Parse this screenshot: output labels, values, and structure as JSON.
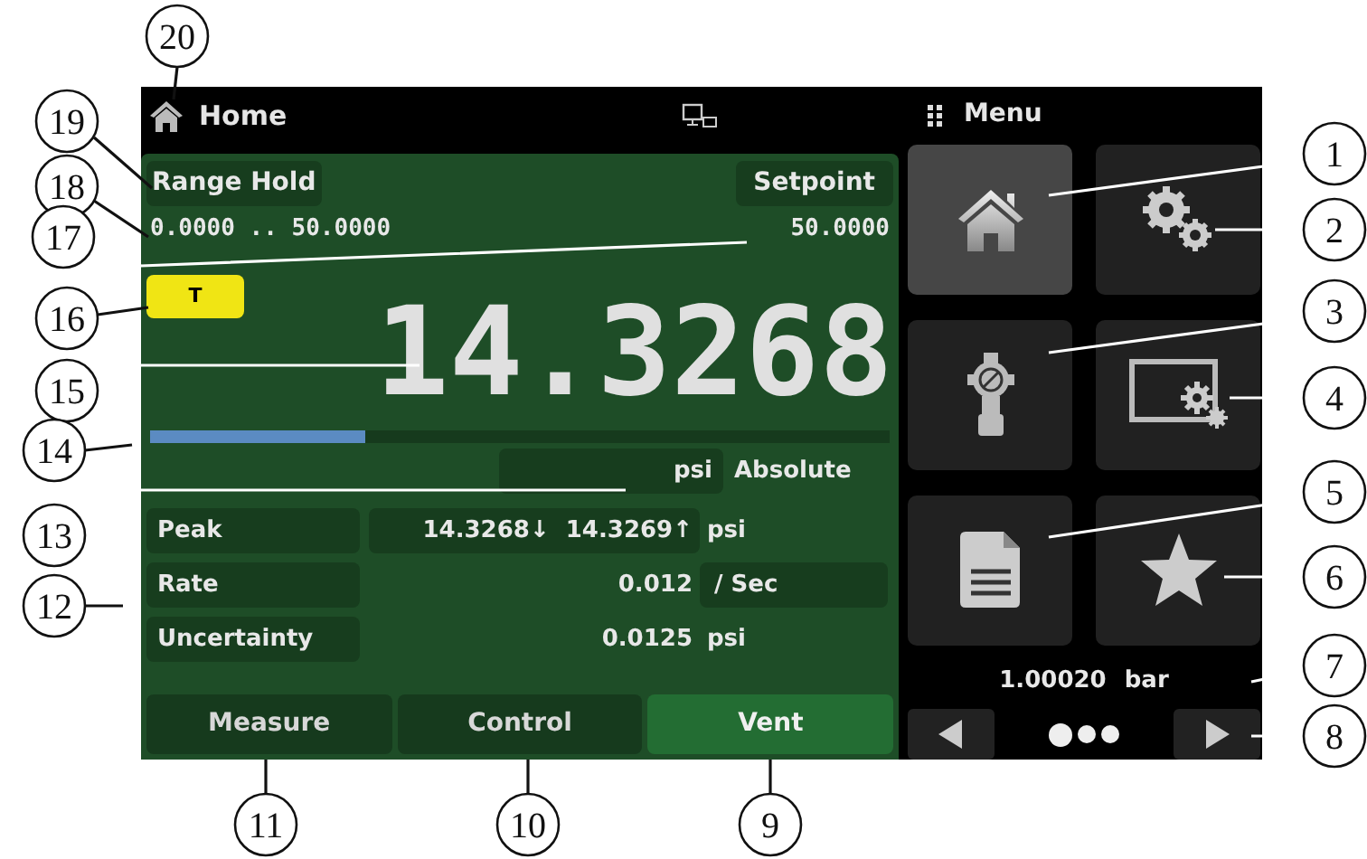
{
  "header": {
    "title": "Home",
    "menu_label": "Menu"
  },
  "panel": {
    "range_hold_button": "Range Hold",
    "setpoint_button": "Setpoint",
    "range": "0.0000 .. 50.0000",
    "setpoint_value": "50.0000",
    "tare_badge": "T",
    "reading": "14.3268",
    "bar": {
      "level": 0.29
    },
    "unit": "psi",
    "mode": "Absolute",
    "rows": [
      {
        "kind": "value_box",
        "label": "Peak",
        "value": "14.3268↓  14.3269↑",
        "unit": "psi"
      },
      {
        "kind": "unit_box",
        "label": "Rate",
        "value": "0.012",
        "unit": "/ Sec"
      },
      {
        "kind": "plain",
        "label": "Uncertainty",
        "value": "0.0125",
        "unit": "psi"
      }
    ]
  },
  "tabs": [
    {
      "label": "Measure",
      "selected": false
    },
    {
      "label": "Control",
      "selected": false
    },
    {
      "label": "Vent",
      "selected": true
    }
  ],
  "menu_tiles": [
    {
      "kind": "home",
      "selected": true
    },
    {
      "kind": "settings",
      "selected": false
    },
    {
      "kind": "sensor",
      "selected": false
    },
    {
      "kind": "display",
      "selected": false
    },
    {
      "kind": "document",
      "selected": false
    },
    {
      "kind": "favorite",
      "selected": false
    }
  ],
  "barometer": {
    "value": "1.00020",
    "unit": "bar"
  },
  "pager_dots": [
    {
      "selected": true
    },
    {
      "selected": false
    },
    {
      "selected": false
    }
  ],
  "left_callouts": [
    "20",
    "19",
    "18",
    "17",
    "16",
    "15",
    "14",
    "13",
    "12"
  ],
  "right_callouts": [
    "1",
    "2",
    "3",
    "4",
    "5",
    "6",
    "7",
    "8"
  ],
  "bottom_callouts": [
    "11",
    "10",
    "9"
  ]
}
